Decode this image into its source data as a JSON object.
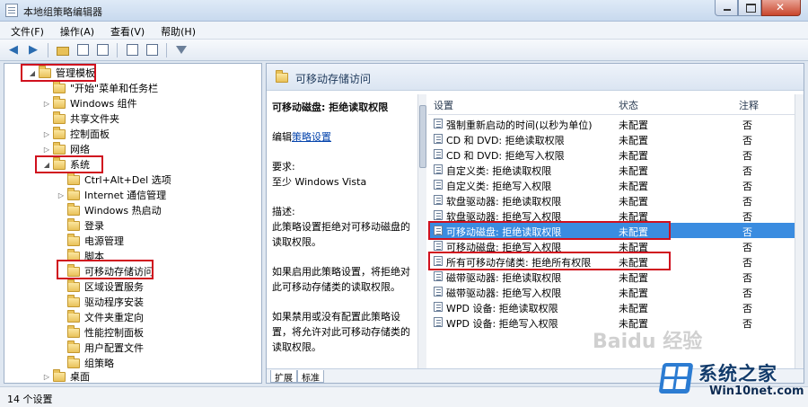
{
  "window": {
    "title": "本地组策略编辑器"
  },
  "menu": [
    "文件(F)",
    "操作(A)",
    "查看(V)",
    "帮助(H)"
  ],
  "tree": {
    "items": [
      {
        "label": "管理模板",
        "twisty": "◢"
      },
      {
        "label": "\"开始\"菜单和任务栏",
        "twisty": ""
      },
      {
        "label": "Windows 组件",
        "twisty": "▷"
      },
      {
        "label": "共享文件夹",
        "twisty": ""
      },
      {
        "label": "控制面板",
        "twisty": "▷"
      },
      {
        "label": "网络",
        "twisty": "▷"
      },
      {
        "label": "系统",
        "twisty": "◢"
      },
      {
        "label": "Ctrl+Alt+Del 选项",
        "twisty": ""
      },
      {
        "label": "Internet 通信管理",
        "twisty": "▷"
      },
      {
        "label": "Windows 热启动",
        "twisty": ""
      },
      {
        "label": "登录",
        "twisty": ""
      },
      {
        "label": "电源管理",
        "twisty": ""
      },
      {
        "label": "脚本",
        "twisty": ""
      },
      {
        "label": "可移动存储访问",
        "twisty": ""
      },
      {
        "label": "区域设置服务",
        "twisty": ""
      },
      {
        "label": "驱动程序安装",
        "twisty": ""
      },
      {
        "label": "文件夹重定向",
        "twisty": ""
      },
      {
        "label": "性能控制面板",
        "twisty": ""
      },
      {
        "label": "用户配置文件",
        "twisty": ""
      },
      {
        "label": "组策略",
        "twisty": ""
      },
      {
        "label": "桌面",
        "twisty": "▷"
      }
    ]
  },
  "main": {
    "header_title": "可移动存储访问",
    "description": {
      "title": "可移动磁盘: 拒绝读取权限",
      "edit_prefix": "编辑",
      "edit_link": "策略设置",
      "requirement_label": "要求:",
      "requirement_value": "至少 Windows Vista",
      "desc_label": "描述:",
      "desc_text": "此策略设置拒绝对可移动磁盘的读取权限。",
      "enabled_text": "如果启用此策略设置，将拒绝对此可移动存储类的读取权限。",
      "disabled_text": "如果禁用或没有配置此策略设置，将允许对此可移动存储类的读取权限。"
    },
    "columns": [
      "设置",
      "状态",
      "注释"
    ],
    "rows": [
      {
        "setting": "强制重新启动的时间(以秒为单位)",
        "state": "未配置",
        "note": "否"
      },
      {
        "setting": "CD 和 DVD: 拒绝读取权限",
        "state": "未配置",
        "note": "否"
      },
      {
        "setting": "CD 和 DVD: 拒绝写入权限",
        "state": "未配置",
        "note": "否"
      },
      {
        "setting": "自定义类: 拒绝读取权限",
        "state": "未配置",
        "note": "否"
      },
      {
        "setting": "自定义类: 拒绝写入权限",
        "state": "未配置",
        "note": "否"
      },
      {
        "setting": "软盘驱动器: 拒绝读取权限",
        "state": "未配置",
        "note": "否"
      },
      {
        "setting": "软盘驱动器: 拒绝写入权限",
        "state": "未配置",
        "note": "否"
      },
      {
        "setting": "可移动磁盘: 拒绝读取权限",
        "state": "未配置",
        "note": "否"
      },
      {
        "setting": "可移动磁盘: 拒绝写入权限",
        "state": "未配置",
        "note": "否"
      },
      {
        "setting": "所有可移动存储类: 拒绝所有权限",
        "state": "未配置",
        "note": "否"
      },
      {
        "setting": "磁带驱动器: 拒绝读取权限",
        "state": "未配置",
        "note": "否"
      },
      {
        "setting": "磁带驱动器: 拒绝写入权限",
        "state": "未配置",
        "note": "否"
      },
      {
        "setting": "WPD 设备: 拒绝读取权限",
        "state": "未配置",
        "note": "否"
      },
      {
        "setting": "WPD 设备: 拒绝写入权限",
        "state": "未配置",
        "note": "否"
      }
    ],
    "tabs": [
      "扩展",
      "标准"
    ]
  },
  "status": {
    "text": "14 个设置"
  },
  "watermark": {
    "text": "Baidu 经验"
  },
  "logo": {
    "name": "系统之家",
    "url": "Win10net.com"
  },
  "colors": {
    "highlight_red": "#d0101e",
    "selected_blue": "#3a8ce0",
    "folder": "#e9c25a"
  }
}
